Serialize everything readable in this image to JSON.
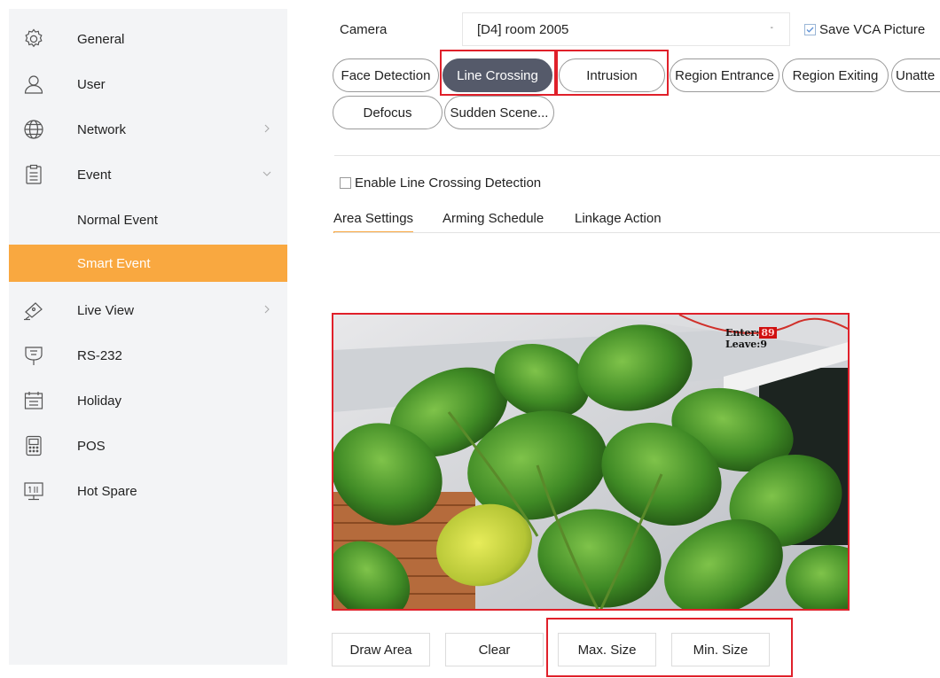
{
  "sidebar": {
    "items": [
      {
        "label": "General",
        "icon": "gear-icon"
      },
      {
        "label": "User",
        "icon": "user-icon"
      },
      {
        "label": "Network",
        "icon": "globe-icon"
      },
      {
        "label": "Event",
        "icon": "clipboard-icon"
      },
      {
        "label": "Normal Event"
      },
      {
        "label": "Smart Event"
      },
      {
        "label": "Live View",
        "icon": "camera-icon"
      },
      {
        "label": "RS-232",
        "icon": "plug-icon"
      },
      {
        "label": "Holiday",
        "icon": "calendar-icon"
      },
      {
        "label": "POS",
        "icon": "pos-terminal-icon"
      },
      {
        "label": "Hot Spare",
        "icon": "hot-spare-icon"
      }
    ],
    "active_color": "#f9a840"
  },
  "camera": {
    "label": "Camera",
    "value": "[D4] room 2005",
    "caret": "-"
  },
  "save_vca": {
    "label": "Save VCA Picture",
    "checked": true
  },
  "detection_tabs": [
    {
      "label": "Face Detection"
    },
    {
      "label": "Line Crossing",
      "selected": true
    },
    {
      "label": "Intrusion"
    },
    {
      "label": "Region Entrance"
    },
    {
      "label": "Region Exiting"
    },
    {
      "label": "Unatte"
    },
    {
      "label": "Defocus"
    },
    {
      "label": "Sudden Scene..."
    }
  ],
  "enable": {
    "label": "Enable Line Crossing Detection",
    "checked": false
  },
  "subtabs": [
    {
      "label": "Area Settings",
      "active": true
    },
    {
      "label": "Arming Schedule"
    },
    {
      "label": "Linkage Action"
    }
  ],
  "osd": {
    "enter_label": "Enter",
    "enter_value": "89",
    "leave_label": "Leave",
    "leave_value": "9"
  },
  "buttons": {
    "draw_area": "Draw Area",
    "clear": "Clear",
    "max_size": "Max. Size",
    "min_size": "Min. Size"
  },
  "colors": {
    "accent": "#f9a840",
    "selected_tab": "#555a6a",
    "highlight": "#e0202a"
  }
}
